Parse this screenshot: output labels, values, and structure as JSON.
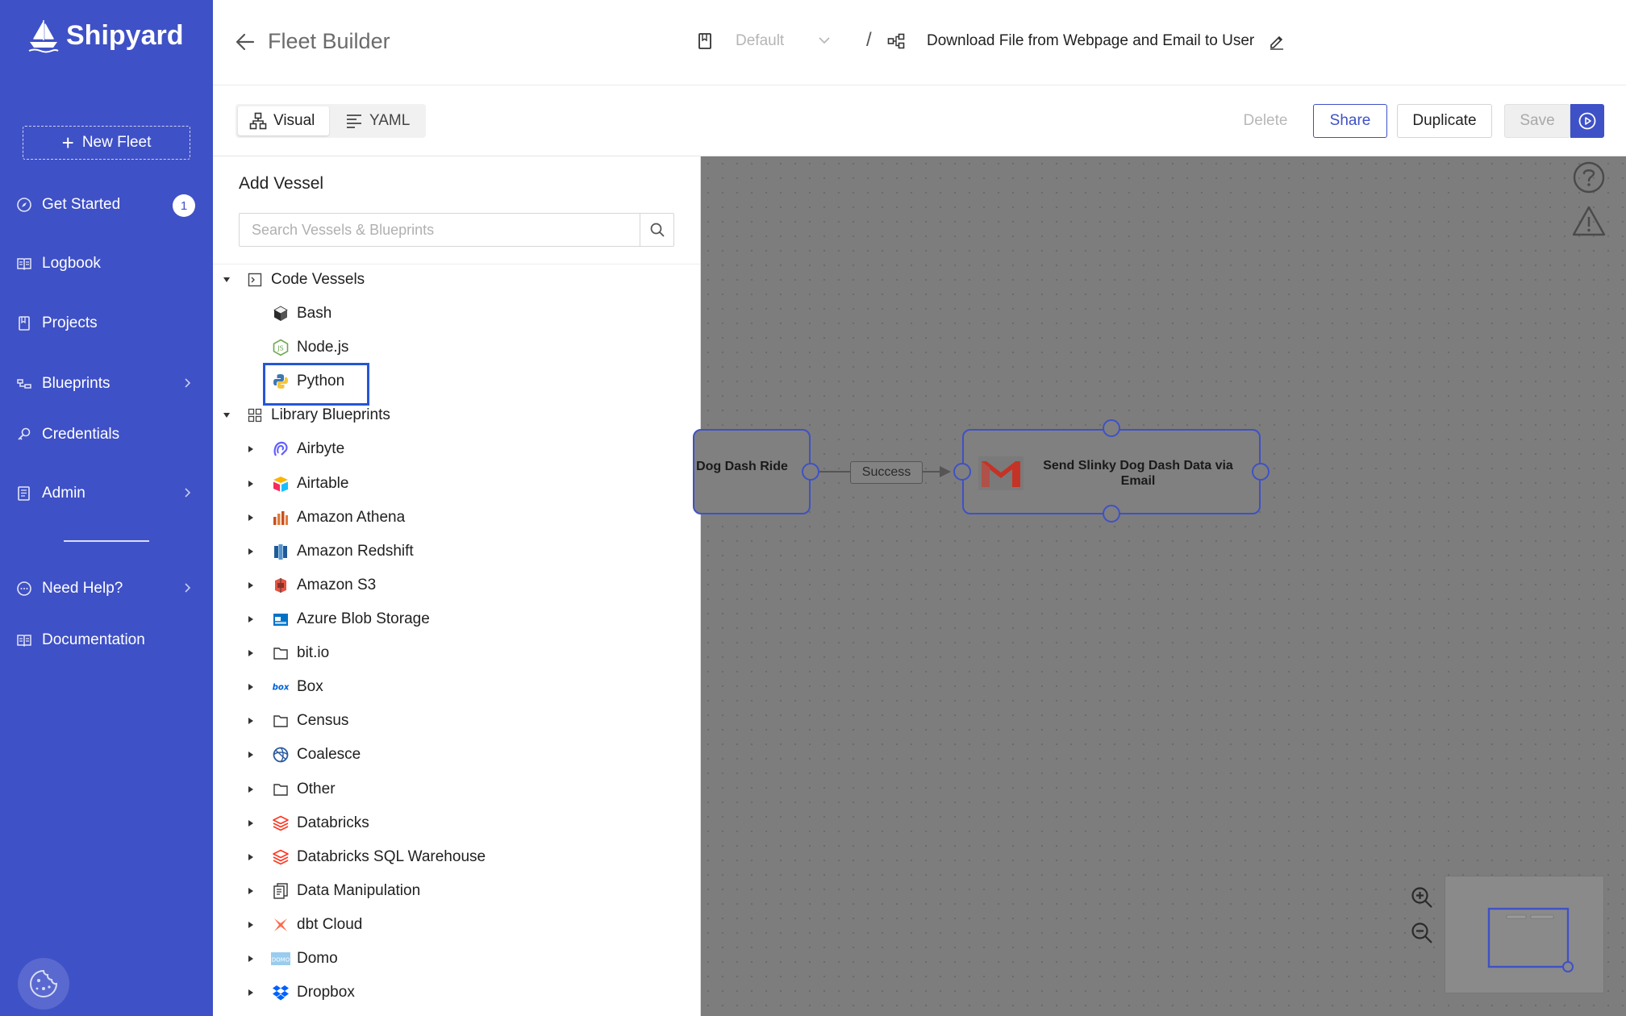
{
  "sidebar": {
    "logo_text": "Shipyard",
    "new_fleet_label": "New Fleet",
    "items": [
      {
        "label": "Get Started",
        "badge": "1"
      },
      {
        "label": "Logbook"
      },
      {
        "label": "Projects"
      },
      {
        "label": "Blueprints"
      },
      {
        "label": "Credentials"
      },
      {
        "label": "Admin"
      },
      {
        "label": "Need Help?"
      },
      {
        "label": "Documentation"
      }
    ]
  },
  "header": {
    "title": "Fleet Builder",
    "project": "Default",
    "separator": "/",
    "fleet_name": "Download File from Webpage and Email to User"
  },
  "toolbar": {
    "visual_label": "Visual",
    "yaml_label": "YAML",
    "delete_label": "Delete",
    "share_label": "Share",
    "duplicate_label": "Duplicate",
    "save_label": "Save"
  },
  "panel": {
    "title": "Add Vessel",
    "search_placeholder": "Search Vessels & Blueprints",
    "code_vessels_label": "Code Vessels",
    "code_vessels": [
      "Bash",
      "Node.js",
      "Python"
    ],
    "library_label": "Library Blueprints",
    "library": [
      "Airbyte",
      "Airtable",
      "Amazon Athena",
      "Amazon Redshift",
      "Amazon S3",
      "Azure Blob Storage",
      "bit.io",
      "Box",
      "Census",
      "Coalesce",
      "Other",
      "Databricks",
      "Databricks SQL Warehouse",
      "Data Manipulation",
      "dbt Cloud",
      "Domo",
      "Dropbox"
    ]
  },
  "canvas": {
    "left_node_label": "Dog Dash Ride",
    "edge_label": "Success",
    "right_node_label": "Send Slinky Dog Dash Data via Email"
  }
}
